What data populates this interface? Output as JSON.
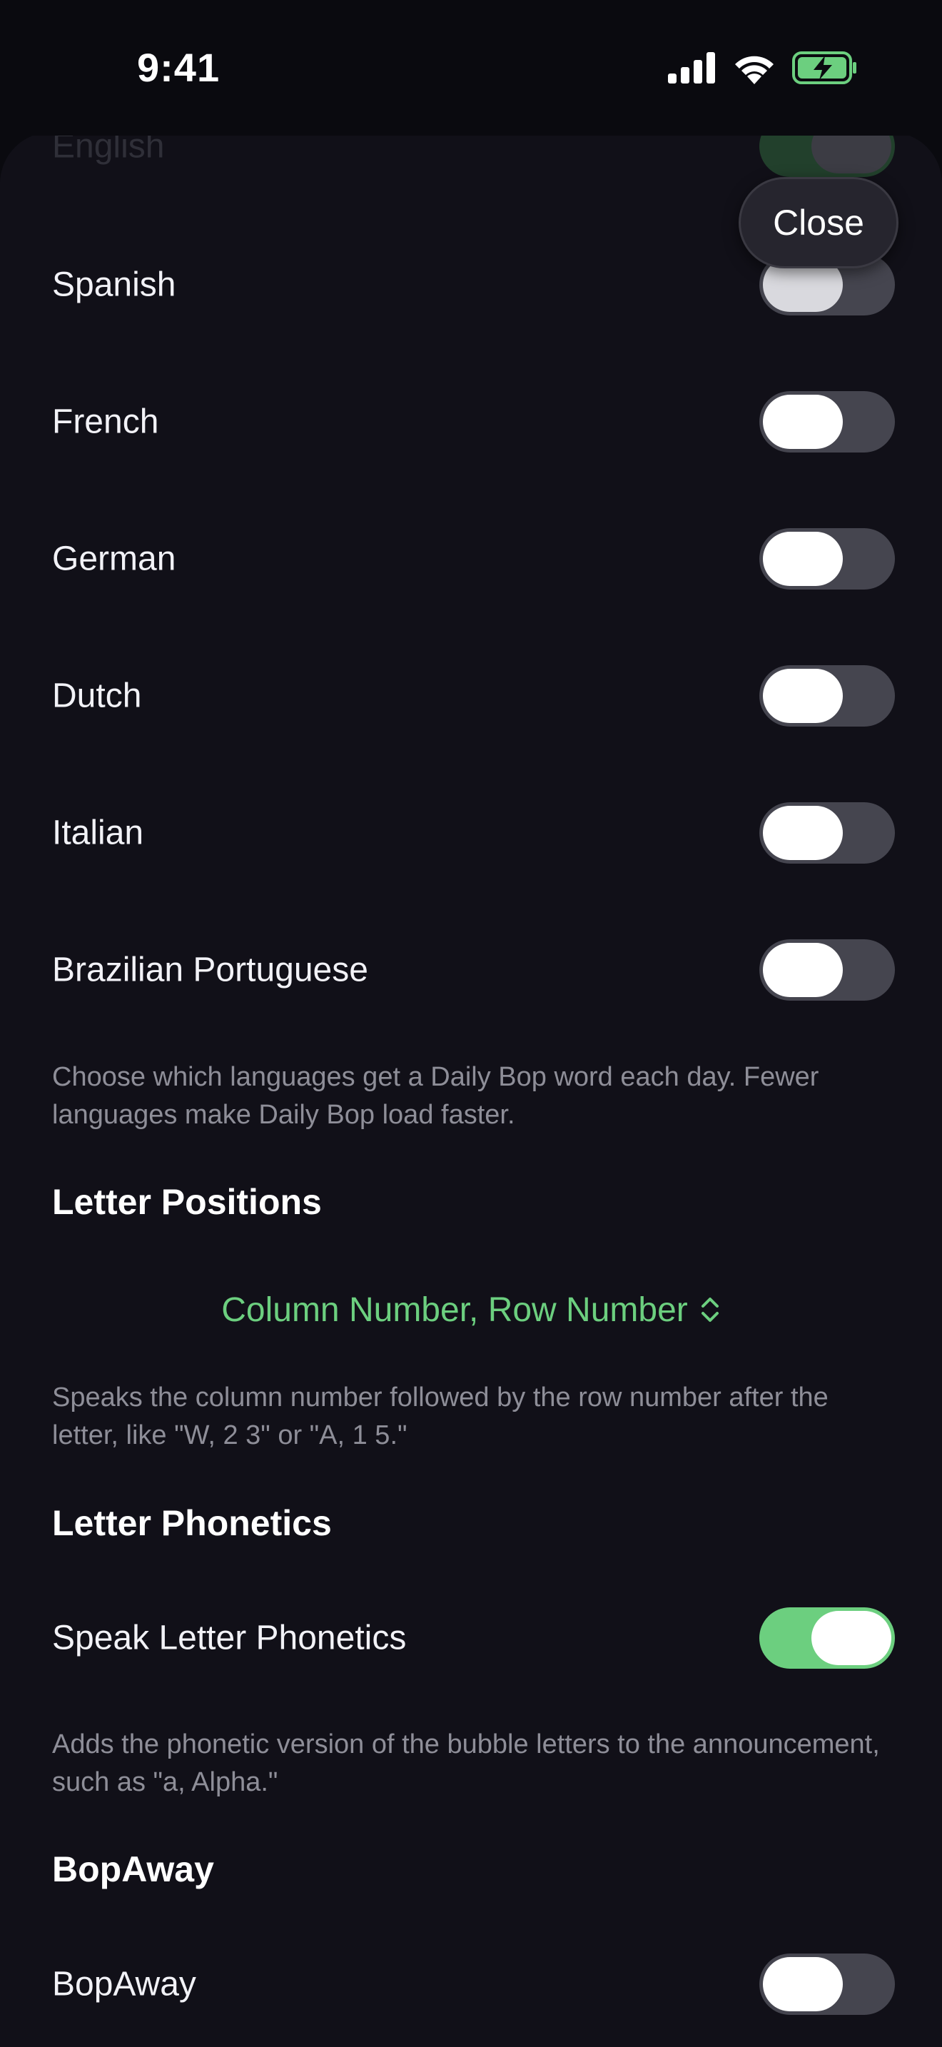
{
  "status": {
    "time": "9:41"
  },
  "close_label": "Close",
  "languages": {
    "english": "English",
    "spanish": "Spanish",
    "french": "French",
    "german": "German",
    "dutch": "Dutch",
    "italian": "Italian",
    "brazilian_portuguese": "Brazilian Portuguese",
    "footer": "Choose which languages get a Daily Bop word each day. Fewer languages make Daily Bop load faster."
  },
  "letter_positions": {
    "header": "Letter Positions",
    "selected": "Column Number, Row Number",
    "footer": "Speaks the column number followed by the row number after the letter, like \"W, 2 3\" or \"A, 1 5.\""
  },
  "letter_phonetics": {
    "header": "Letter Phonetics",
    "toggle_label": "Speak Letter Phonetics",
    "footer": "Adds the phonetic version of the bubble letters to the announcement, such as \"a, Alpha.\""
  },
  "bopaway": {
    "header": "BopAway",
    "toggle_label": "BopAway"
  },
  "toggle_states": {
    "english": true,
    "spanish": false,
    "french": false,
    "german": false,
    "dutch": false,
    "italian": false,
    "brazilian_portuguese": false,
    "speak_letter_phonetics": true,
    "bopaway": false
  },
  "colors": {
    "accent": "#6ccf7f",
    "background": "#111018",
    "toggle_off": "#45454f"
  },
  "icons": [
    "cellular-signal-icon",
    "wifi-icon",
    "battery-charging-icon",
    "chevron-up-down-icon"
  ]
}
